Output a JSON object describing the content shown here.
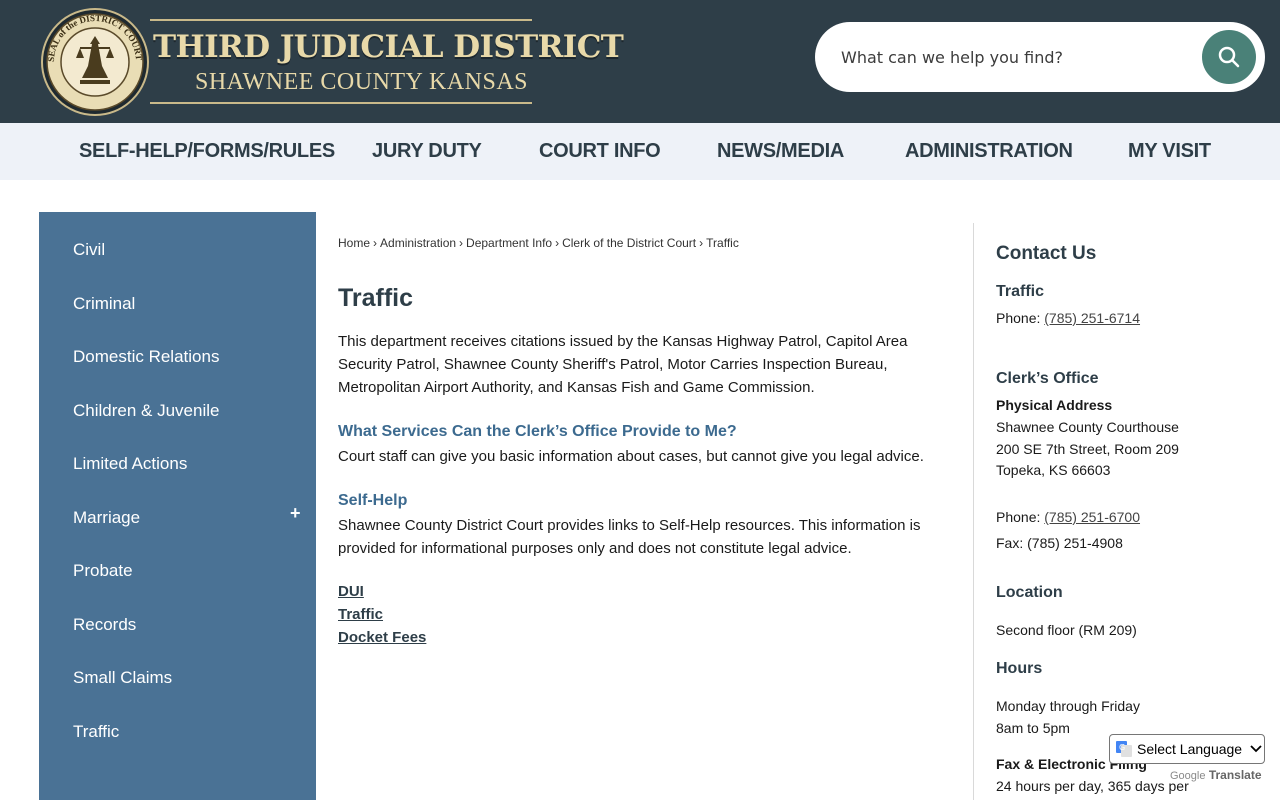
{
  "header": {
    "seal_text": "SEAL of the DISTRICT COURT",
    "title": "THIRD JUDICIAL DISTRICT",
    "subtitle": "SHAWNEE COUNTY KANSAS",
    "search_placeholder": "What can we help you find?"
  },
  "nav": {
    "items": [
      "SELF-HELP/FORMS/RULES",
      "JURY DUTY",
      "COURT INFO",
      "NEWS/MEDIA",
      "ADMINISTRATION",
      "MY VISIT"
    ]
  },
  "sidebar": {
    "items": [
      "Civil",
      "Criminal",
      "Domestic Relations",
      "Children & Juvenile",
      "Limited Actions",
      "Marriage",
      "Probate",
      "Records",
      "Small Claims",
      "Traffic"
    ],
    "expand_symbol": "+"
  },
  "breadcrumb": {
    "items": [
      "Home",
      "Administration",
      "Department Info",
      "Clerk of the District Court",
      "Traffic"
    ],
    "separator": "›"
  },
  "main": {
    "title": "Traffic",
    "intro": "This department receives citations issued by the Kansas Highway Patrol, Capitol Area Security Patrol, Shawnee County Sheriff's Patrol, Motor Carries Inspection Bureau, Metropolitan Airport Authority, and Kansas Fish and Game Commission.",
    "services_heading": "What Services Can the Clerk’s Office Provide to Me?",
    "services_text": "Court staff can give you basic information about cases, but cannot give you legal advice.",
    "selfhelp_heading": "Self-Help",
    "selfhelp_text": "Shawnee County District Court provides links to Self-Help resources.  This information is provided for informational purposes only and does not constitute legal advice.",
    "links": [
      "DUI",
      "Traffic",
      "Docket Fees"
    ]
  },
  "contact": {
    "heading": "Contact Us",
    "traffic_heading": "Traffic",
    "phone_label": "Phone: ",
    "traffic_phone": "(785) 251-6714",
    "clerk_heading": "Clerk’s Office",
    "physical_label": "Physical Address",
    "address_line1": "Shawnee County Courthouse",
    "address_line2": "200 SE 7th Street, Room 209",
    "address_line3": "Topeka, KS 66603",
    "clerk_phone": "(785) 251-6700",
    "fax": "Fax: (785) 251-4908",
    "location_heading": "Location",
    "location_text": "Second floor (RM 209)",
    "hours_heading": "Hours",
    "hours_days": "Monday through Friday",
    "hours_time": "8am to 5pm",
    "fax_filing_heading": "Fax & Electronic Filing",
    "fax_filing_text": "24 hours per day, 365 days per"
  },
  "translate": {
    "select_label": "Select Language",
    "google": "Google",
    "translate": "Translate"
  }
}
